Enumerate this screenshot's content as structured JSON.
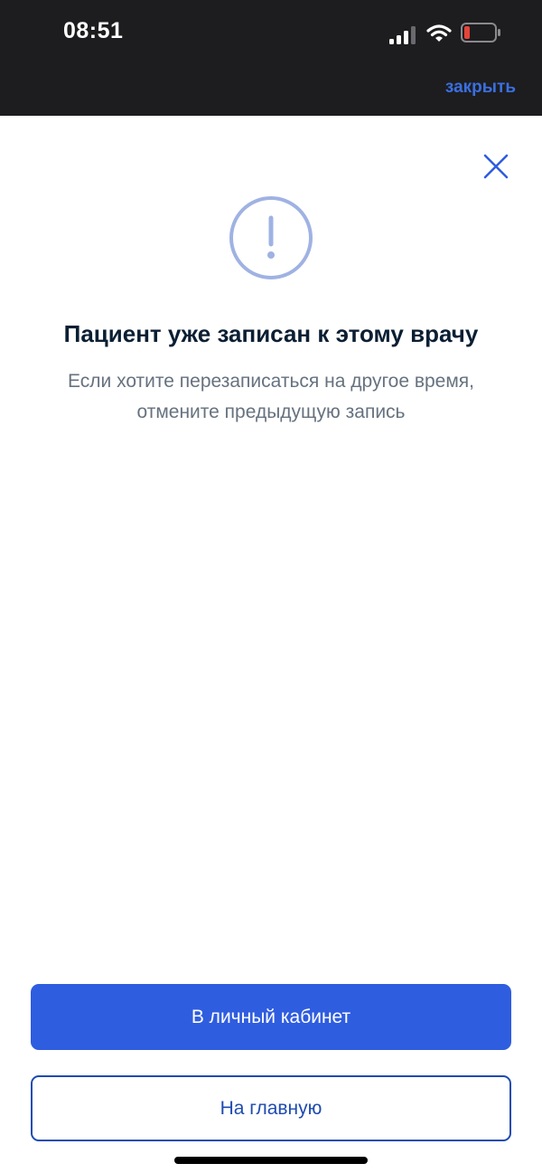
{
  "status_bar": {
    "time": "08:51",
    "icons": [
      "cellular-signal-icon",
      "wifi-icon",
      "battery-low-icon"
    ]
  },
  "header": {
    "close_link_label": "закрыть"
  },
  "dialog": {
    "close_icon": "close-icon",
    "alert_icon": "exclamation-circle-icon",
    "title": "Пациент уже записан к этому врачу",
    "subtitle_line1": "Если хотите перезаписаться на другое время,",
    "subtitle_line2": "отмените предыдущую запись"
  },
  "actions": {
    "primary_label": "В личный кабинет",
    "secondary_label": "На главную"
  },
  "colors": {
    "accent": "#2f5de0",
    "link": "#3a6fe0",
    "title": "#0b1f33",
    "subtitle": "#66727f",
    "alert_icon": "#9fb2e3",
    "battery_low": "#e5443a"
  }
}
